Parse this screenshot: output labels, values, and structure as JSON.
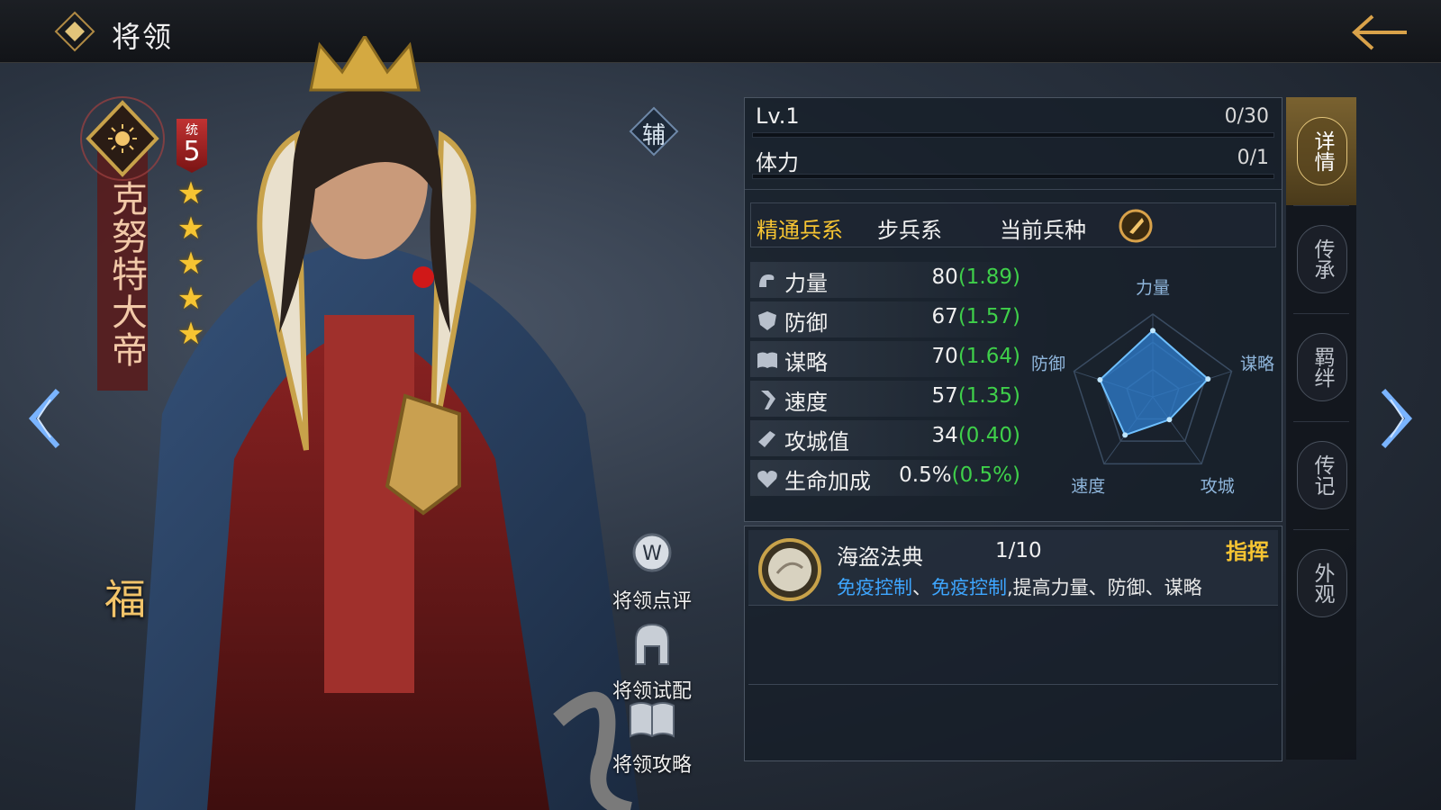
{
  "header": {
    "title": "将领"
  },
  "hero": {
    "name": "克努特大帝",
    "command_label": "统",
    "command_value": "5",
    "stars": 5,
    "fortune_mark": "福",
    "aux_label": "辅"
  },
  "actions": [
    {
      "label": "将领点评",
      "icon": "comment-icon"
    },
    {
      "label": "将领试配",
      "icon": "helmet-icon"
    },
    {
      "label": "将领攻略",
      "icon": "book-icon"
    }
  ],
  "level": {
    "label": "Lv.1",
    "value": "0/30",
    "progress": 0
  },
  "stamina": {
    "label": "体力",
    "value": "0/1",
    "progress": 0
  },
  "troops": {
    "mastery_label": "精通兵系",
    "mastery_value": "步兵系",
    "current_label": "当前兵种"
  },
  "attributes": [
    {
      "name": "力量",
      "value": "80",
      "growth": "(1.89)",
      "icon": "strength-icon"
    },
    {
      "name": "防御",
      "value": "67",
      "growth": "(1.57)",
      "icon": "shield-icon"
    },
    {
      "name": "谋略",
      "value": "70",
      "growth": "(1.64)",
      "icon": "book-icon"
    },
    {
      "name": "速度",
      "value": "57",
      "growth": "(1.35)",
      "icon": "boot-icon"
    },
    {
      "name": "攻城值",
      "value": "34",
      "growth": "(0.40)",
      "icon": "siege-icon"
    },
    {
      "name": "生命加成",
      "value": "0.5%",
      "growth": "(0.5%)",
      "icon": "heart-icon"
    }
  ],
  "radar": {
    "labels": [
      "力量",
      "谋略",
      "攻城",
      "速度",
      "防御"
    ],
    "values": [
      0.8,
      0.7,
      0.34,
      0.57,
      0.67
    ]
  },
  "skill": {
    "name": "海盗法典",
    "level": "1/10",
    "type": "指挥",
    "desc_hl1": "免疫控制",
    "desc_sep1": "、",
    "desc_hl2": "免疫控制",
    "desc_rest": ",提高力量、防御、谋略"
  },
  "tabs": [
    {
      "label": "详情",
      "active": true
    },
    {
      "label": "传承",
      "active": false
    },
    {
      "label": "羁绊",
      "active": false
    },
    {
      "label": "传记",
      "active": false
    },
    {
      "label": "外观",
      "active": false
    }
  ],
  "colors": {
    "gold": "#f6c432",
    "growth_green": "#3fd04a",
    "skill_blue": "#3ea6ff",
    "radar_fill": "#2f7fd0"
  }
}
